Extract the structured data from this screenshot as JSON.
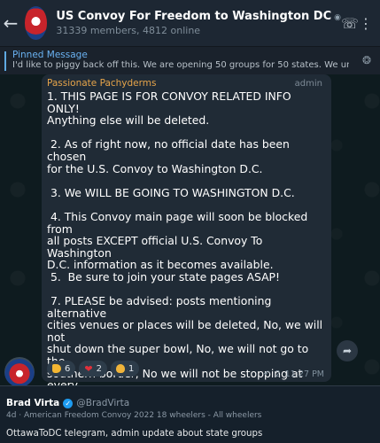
{
  "header": {
    "title": "US Convoy For Freedom to Washington DC",
    "subtitle": "31339 members, 4812 online"
  },
  "pinned": {
    "label": "Pinned Message",
    "text": "I'd like to piggy back off this. We are opening 50 groups for 50 states. We understa..."
  },
  "message": {
    "sender": "Passionate Pachyderms",
    "role": "admin",
    "text": "1. THIS PAGE IS FOR CONVOY RELATED INFO ONLY!\nAnything else will be deleted.\n\n 2. As of right now, no official date has been chosen\nfor the U.S. Convoy to Washington D.C.\n\n 3. We WILL BE GOING TO WASHINGTON D.C.\n\n 4. This Convoy main page will soon be blocked from\nall posts EXCEPT official U.S. Convoy To Washington\nD.C. information as it becomes available.\n 5.  Be sure to join your state pages ASAP!\n\n 7. PLEASE be advised: posts mentioning alternative\ncities venues or places will be deleted, No, we will not\nshut down the super bowl, No, we will not go to the\nsouthern border, No we will not be stopping at every\nstates capital. Yes we do care about human trafficing,\nbut that is NOT for this particular fight. Just need to\nget those out of the way, as they will not be happening.",
    "reactions": [
      {
        "emoji": "thumbs-up",
        "count": "6"
      },
      {
        "emoji": "heart",
        "count": "2"
      },
      {
        "emoji": "clap",
        "count": "1"
      }
    ],
    "shares": "2",
    "time": "11:27 PM"
  },
  "tweet": {
    "name": "Brad Virta",
    "handle": "@BradVirta",
    "meta": "4d · American Freedom Convoy 2022 18 wheelers - All wheelers",
    "body": "OttawaToDC telegram, admin update about state groups"
  },
  "colors": {
    "accent": "#6ab2f2",
    "sender": "#e6a44a",
    "bubble": "#202b36"
  }
}
